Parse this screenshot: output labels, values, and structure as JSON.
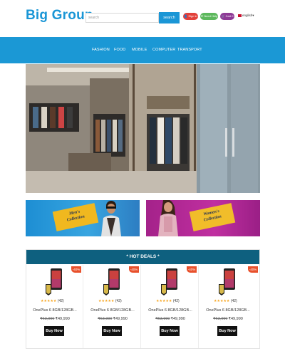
{
  "brand": {
    "name": "Big Group",
    "color": "#1a96d6"
  },
  "search": {
    "placeholder": "search",
    "button_label": "search"
  },
  "header_actions": {
    "signin": "Sign In",
    "help": "Need Help",
    "cart": "Cart 0",
    "language": "english"
  },
  "nav": {
    "items": [
      "FASHION",
      "FOOD",
      "MOBILE",
      "COMPUTER",
      "TRANSPORT"
    ]
  },
  "banners": {
    "men": {
      "line1": "Men's",
      "line2": "Collection"
    },
    "women": {
      "line1": "Women's",
      "line2": "Collection"
    }
  },
  "deals": {
    "title": "* HOT DEALS *",
    "products": [
      {
        "discount": "-40%",
        "rating_count": "(42)",
        "name": "OnePlus 6 8GB/128GB...",
        "old_price": "₹63,990",
        "price": "₹49,990",
        "button": "Buy Now"
      },
      {
        "discount": "-40%",
        "rating_count": "(42)",
        "name": "OnePlus 6 8GB/128GB...",
        "old_price": "₹63,990",
        "price": "₹49,990",
        "button": "Buy Now"
      },
      {
        "discount": "-40%",
        "rating_count": "(42)",
        "name": "OnePlus 6 8GB/128GB...",
        "old_price": "₹63,990",
        "price": "₹49,990",
        "button": "Buy Now"
      },
      {
        "discount": "-40%",
        "rating_count": "(42)",
        "name": "OnePlus 6 8GB/128GB...",
        "old_price": "₹63,990",
        "price": "₹49,990",
        "button": "Buy Now"
      }
    ],
    "rating_stars": 5
  },
  "colors": {
    "nav_bg": "#1b98d5",
    "deals_header_bg": "#0e607f",
    "signin": "#e2403a",
    "help": "#5cb85c",
    "cart": "#8e3a96",
    "discount_badge": "#e8502b"
  }
}
